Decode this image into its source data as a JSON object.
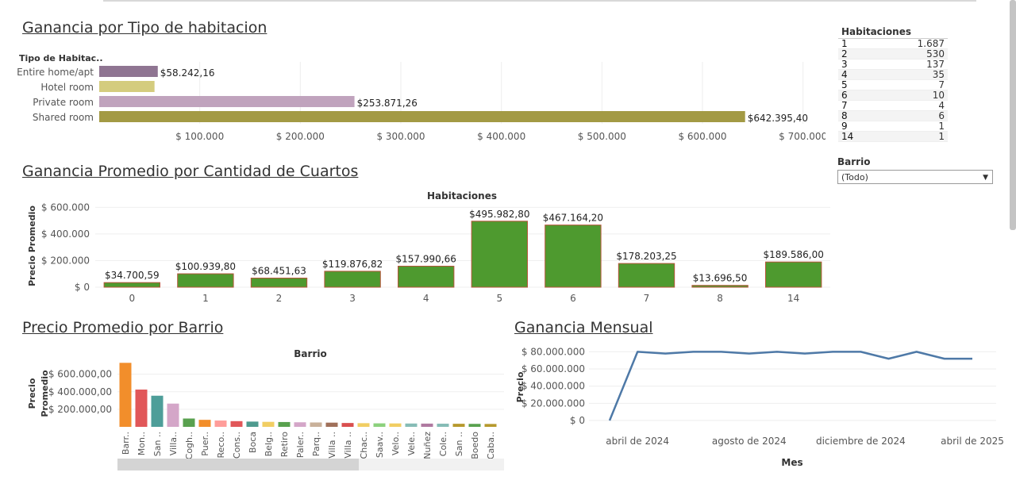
{
  "titles": {
    "ganancia_tipo": "Ganancia por Tipo de habitacion",
    "ganancia_promedio": "Ganancia Promedio por Cantidad de Cuartos",
    "precio_barrio": "Precio Promedio por Barrio",
    "ganancia_mensual": "Ganancia Mensual"
  },
  "habitaciones_table": {
    "header": "Habitaciones",
    "rows": [
      {
        "k": "1",
        "v": "1.687"
      },
      {
        "k": "2",
        "v": "530"
      },
      {
        "k": "3",
        "v": "137"
      },
      {
        "k": "4",
        "v": "35"
      },
      {
        "k": "5",
        "v": "7"
      },
      {
        "k": "6",
        "v": "10"
      },
      {
        "k": "7",
        "v": "4"
      },
      {
        "k": "8",
        "v": "6"
      },
      {
        "k": "9",
        "v": "1"
      },
      {
        "k": "14",
        "v": "1"
      }
    ]
  },
  "filter": {
    "label": "Barrio",
    "value": "(Todo)"
  },
  "chart_data": [
    {
      "type": "bar",
      "orientation": "horizontal",
      "title": "Ganancia por Tipo de habitacion",
      "category_header": "Tipo de Habitac..",
      "categories": [
        "Entire home/apt",
        "Hotel room",
        "Private room",
        "Shared room"
      ],
      "values": [
        58242.16,
        55000,
        253871.26,
        642395.4
      ],
      "data_labels": [
        "$58.242,16",
        "",
        "$253.871,26",
        "$642.395,40"
      ],
      "colors": [
        "#8f7592",
        "#d4cc7e",
        "#c0a3bd",
        "#a39a44"
      ],
      "xlim": [
        0,
        720000
      ],
      "x_ticks": [
        100000,
        200000,
        300000,
        400000,
        500000,
        600000,
        700000
      ],
      "x_tick_labels": [
        "$ 100.000",
        "$ 200.000",
        "$ 300.000",
        "$ 400.000",
        "$ 500.000",
        "$ 600.000",
        "$ 700.000"
      ]
    },
    {
      "type": "bar",
      "title": "Ganancia Promedio por Cantidad de Cuartos",
      "header": "Habitaciones",
      "ylabel": "Precio Promedio",
      "categories": [
        "0",
        "1",
        "2",
        "3",
        "4",
        "5",
        "6",
        "7",
        "8",
        "14"
      ],
      "values": [
        34700.59,
        100939.8,
        68451.63,
        119876.82,
        157990.66,
        495982.8,
        467164.2,
        178203.25,
        13696.5,
        189586.0
      ],
      "data_labels": [
        "$34.700,59",
        "$100.939,80",
        "$68.451,63",
        "$119.876,82",
        "$157.990,66",
        "$495.982,80",
        "$467.164,20",
        "$178.203,25",
        "$13.696,50",
        "$189.586,00"
      ],
      "color": "#4e9a2f",
      "ylim": [
        0,
        620000
      ],
      "y_ticks": [
        0,
        200000,
        400000,
        600000
      ],
      "y_tick_labels": [
        "$ 0",
        "$ 200.000",
        "$ 400.000",
        "$ 600.000"
      ]
    },
    {
      "type": "bar",
      "title": "Precio Promedio por Barrio",
      "header": "Barrio",
      "ylabel": "Precio Promedio",
      "categories": [
        "Barr..",
        "Mon..",
        "San ..",
        "Villa..",
        "Cogh..",
        "Puer..",
        "Reco..",
        "Cons..",
        "Boca",
        "Belg..",
        "Retiro",
        "Paler..",
        "Parq..",
        "Villa ..",
        "Villa ..",
        "Chac..",
        "Saav..",
        "Velo..",
        "Vele..",
        "Nuñez",
        "Cole..",
        "San ..",
        "Boedo",
        "Caba.."
      ],
      "values": [
        730000,
        425000,
        355000,
        265000,
        95000,
        80000,
        72000,
        65000,
        60000,
        57000,
        55000,
        52000,
        50000,
        48000,
        44000,
        42000,
        40000,
        39000,
        38000,
        37000,
        36000,
        35000,
        34000,
        33000
      ],
      "colors": [
        "#f28e2b",
        "#e15759",
        "#4e9e99",
        "#d4a6c8",
        "#59a14f",
        "#f28e2b",
        "#ff9d9a",
        "#e15759",
        "#4e9a8e",
        "#f1ce63",
        "#59a14f",
        "#d4a6c8",
        "#c9b19a",
        "#a0705a",
        "#d94f4f",
        "#f1ce63",
        "#8cd17d",
        "#f1ce63",
        "#86bcb6",
        "#b07aa1",
        "#86bcb6",
        "#b6992d",
        "#59a14f",
        "#b6992d"
      ],
      "ylim": [
        0,
        760000
      ],
      "y_ticks": [
        200000,
        400000,
        600000
      ],
      "y_tick_labels": [
        "$ 200.000,00",
        "$ 400.000,00",
        "$ 600.000,00"
      ]
    },
    {
      "type": "line",
      "title": "Ganancia Mensual",
      "xlabel": "Mes",
      "ylabel": "Precio",
      "x": [
        "2024-03",
        "2024-04",
        "2024-05",
        "2024-06",
        "2024-07",
        "2024-08",
        "2024-09",
        "2024-10",
        "2024-11",
        "2024-12",
        "2025-01",
        "2025-02",
        "2025-03",
        "2025-04"
      ],
      "values": [
        0,
        80000000,
        78000000,
        80000000,
        80000000,
        78000000,
        80000000,
        78000000,
        80000000,
        80000000,
        72000000,
        80000000,
        72000000,
        72000000
      ],
      "x_tick_labels": [
        "abril de 2024",
        "agosto de 2024",
        "diciembre de 2024",
        "abril de 2025"
      ],
      "x_tick_index": [
        1,
        5,
        9,
        13
      ],
      "ylim": [
        0,
        85000000
      ],
      "y_ticks": [
        0,
        20000000,
        40000000,
        60000000,
        80000000
      ],
      "y_tick_labels": [
        "$ 0",
        "$ 20.000.000",
        "$ 40.000.000",
        "$ 60.000.000",
        "$ 80.000.000"
      ],
      "color": "#4e79a7"
    }
  ]
}
